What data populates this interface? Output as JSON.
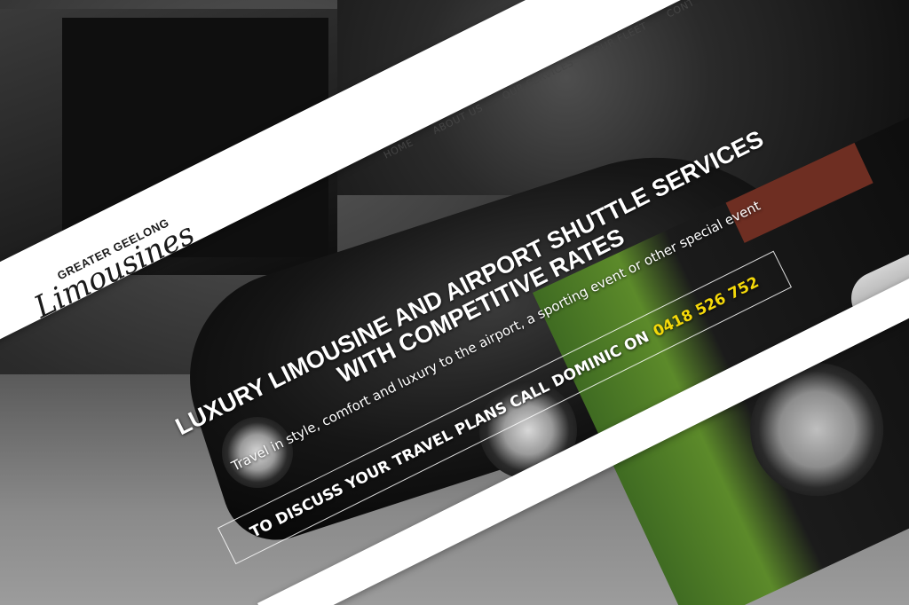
{
  "brand": {
    "sub": "Greater Geelong",
    "main": "Limousines"
  },
  "nav": {
    "items": [
      {
        "label": "Home"
      },
      {
        "label": "About Us"
      },
      {
        "label": "Our Services"
      },
      {
        "label": "Our Fleet"
      },
      {
        "label": "Cont"
      }
    ]
  },
  "hero": {
    "headline": "Luxury Limousine and Airport Shuttle Services with Competitive Rates",
    "subtitle": "Travel in style, comfort and luxury to the airport, a sporting event or other special event"
  },
  "cta": {
    "text": "To discuss your travel plans call Dominic on",
    "phone": "0418 526 752"
  },
  "colors": {
    "accent_phone": "#f5d90a",
    "nav_bg": "#ffffff",
    "hero_text": "#ffffff"
  }
}
